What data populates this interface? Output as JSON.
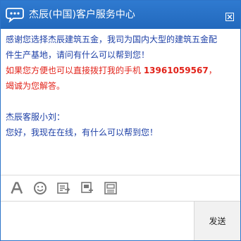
{
  "window": {
    "title": "杰辰(中国)客户服务中心",
    "icons": {
      "title": "chat-bubble-icon",
      "close": "close-box-icon"
    }
  },
  "chat": {
    "welcome_line": "感谢您选择杰辰建筑五金，我司为国内大型的建筑五金配件生产基地，请问有什么可以帮到您！",
    "phone_prefix": "如果您方便也可以直接拨打我的手机 ",
    "phone_number": "13961059567",
    "phone_suffix": "，竭诚为您解答。",
    "agent_name": "杰辰客服小刘：",
    "agent_message": "您好，我现在在线，有什么可以帮到您！"
  },
  "toolbar": {
    "icons": [
      "font-icon",
      "emoji-icon",
      "screenshot-icon",
      "file-send-icon",
      "chat-history-icon"
    ]
  },
  "input": {
    "value": "",
    "placeholder": ""
  },
  "send": {
    "label": "发送"
  },
  "colors": {
    "title_bar": "#2a72c6",
    "message_blue": "#1c3fa6",
    "message_red": "#e2231a",
    "toolbar_icon": "#777777"
  }
}
